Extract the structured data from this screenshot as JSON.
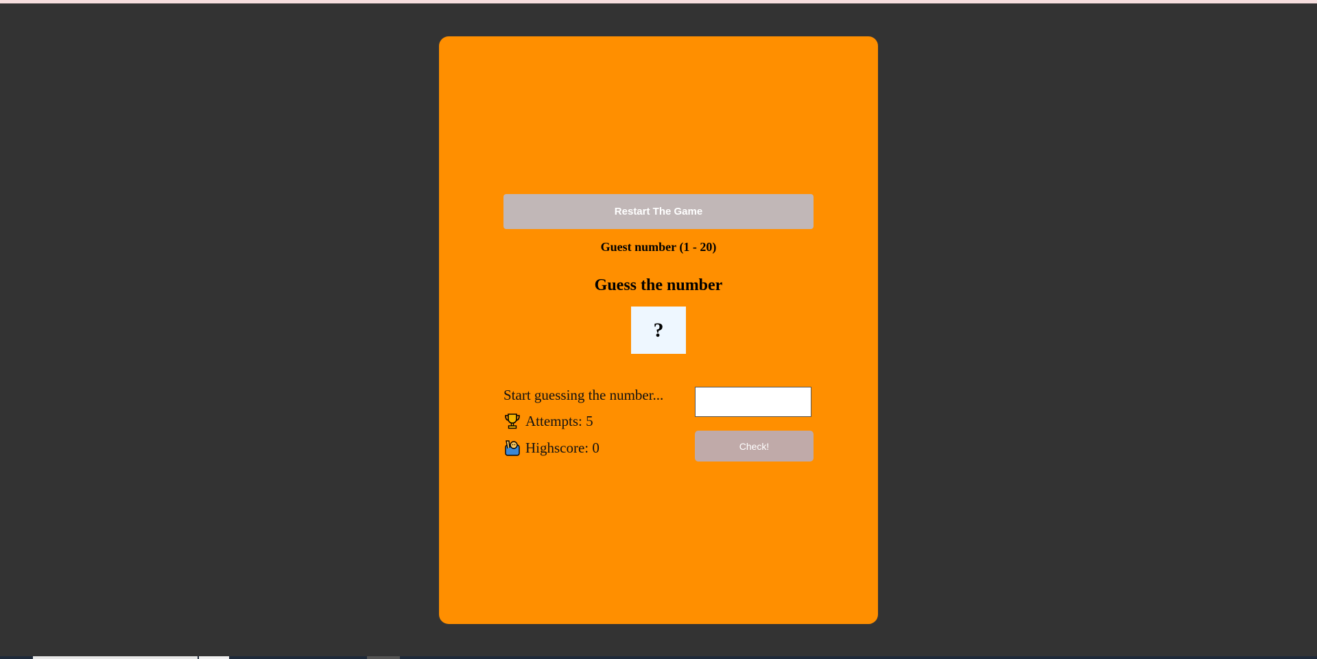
{
  "game": {
    "restart_label": "Restart The Game",
    "range_label": "Guest number (1 - 20)",
    "title": "Guess the number",
    "secret_number": "?",
    "message": "Start guessing the number...",
    "attempts_label": "Attempts: 5",
    "highscore_label": "Highscore: 0",
    "guess_value": "",
    "check_label": "Check!"
  },
  "icons": {
    "attempts": "trophy-icon",
    "highscore": "person-raising-hand-icon"
  },
  "colors": {
    "background": "#333333",
    "card": "#ff8f00",
    "restart_button": "#c1b7b7",
    "check_button": "#c0aaa9",
    "secret_box": "#eef7ff"
  }
}
